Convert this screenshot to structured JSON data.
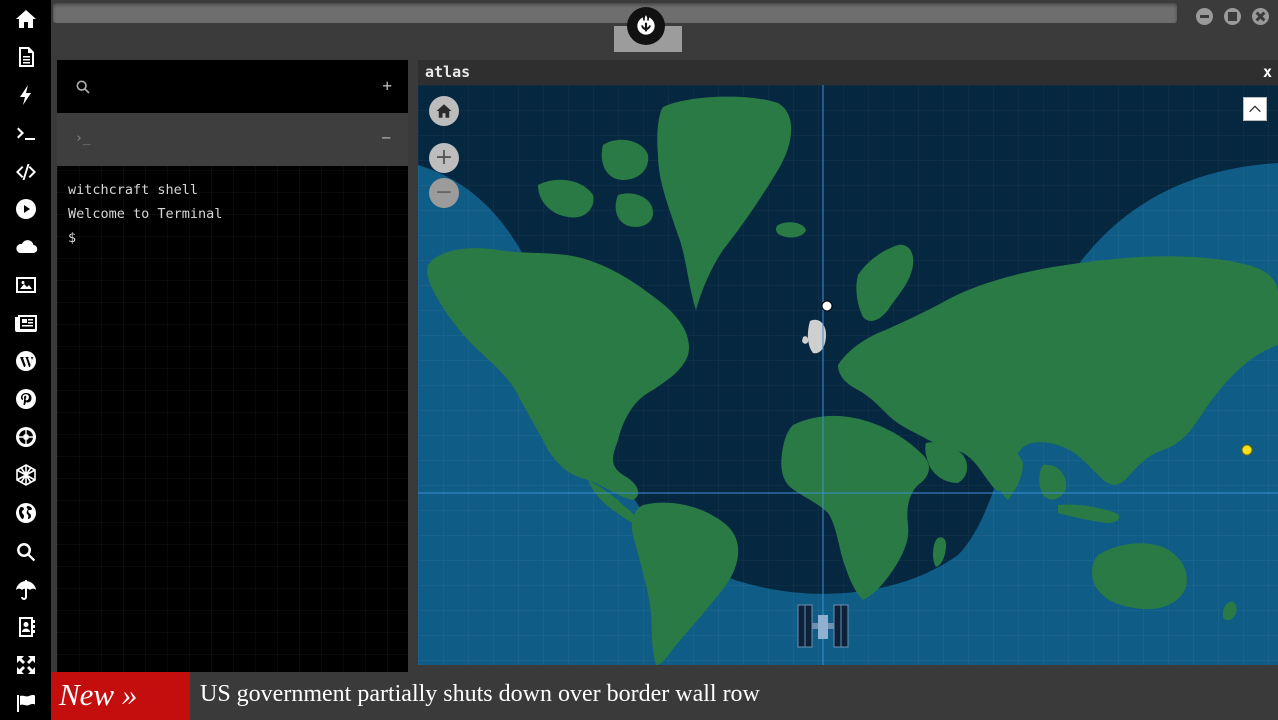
{
  "sidebar": {
    "icons": [
      "home-icon",
      "document-icon",
      "bolt-icon",
      "terminal-icon",
      "code-icon",
      "play-icon",
      "cloud-icon",
      "image-icon",
      "news-icon",
      "wordpress-icon",
      "pinterest-icon",
      "galactic-empire-icon",
      "globe-wireframe-icon",
      "earth-icon",
      "search-icon",
      "umbrella-icon",
      "contacts-icon",
      "expand-arrows-icon",
      "flag-icon"
    ]
  },
  "window_controls": [
    "minimize",
    "maximize",
    "close"
  ],
  "terminal": {
    "search_placeholder": "",
    "add_label": "+",
    "tab_prompt": "›_",
    "tab_collapse_label": "−",
    "lines": [
      "witchcraft shell",
      "Welcome to Terminal",
      "$"
    ]
  },
  "atlas": {
    "title": "atlas",
    "close_label": "x",
    "zoom_in_label": "+",
    "zoom_out_label": "−"
  },
  "ticker": {
    "badge": "New »",
    "headline": "US government partially shuts down over border wall row"
  },
  "colors": {
    "ocean_day": "#0f5c87",
    "ocean_night": "#062740",
    "land": "#2a7a45",
    "badge": "#c40d0d"
  }
}
